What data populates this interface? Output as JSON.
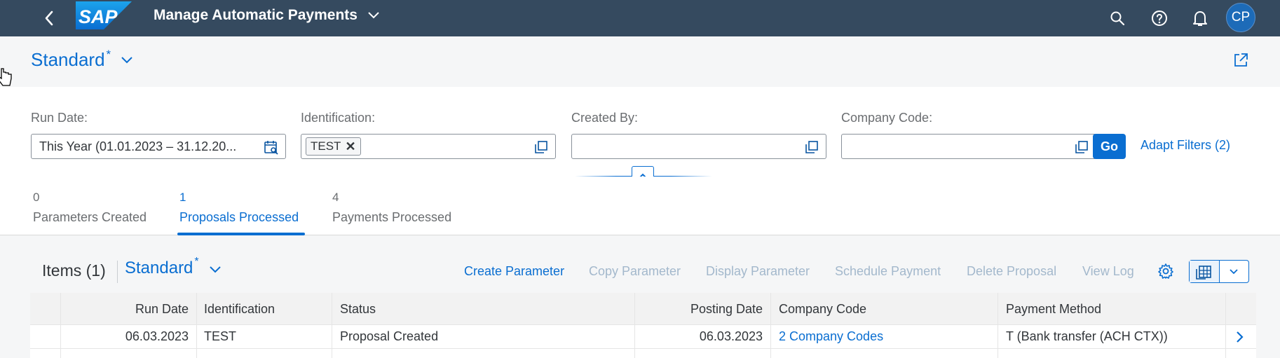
{
  "shell": {
    "app_title": "Manage Automatic Payments",
    "logo_text": "SAP",
    "avatar_initials": "CP"
  },
  "page_variant": {
    "name": "Standard",
    "modified_marker": "*"
  },
  "filters": [
    {
      "label": "Run Date:",
      "value": "This Year (01.01.2023 – 31.12.20..."
    },
    {
      "label": "Identification:",
      "tokens": [
        "TEST"
      ]
    },
    {
      "label": "Created By:",
      "value": ""
    },
    {
      "label": "Company Code:",
      "value": ""
    }
  ],
  "filter_actions": {
    "go_label": "Go",
    "adapt_label": "Adapt Filters (2)"
  },
  "tabs": [
    {
      "count": "0",
      "label": "Parameters Created",
      "active": false
    },
    {
      "count": "1",
      "label": "Proposals Processed",
      "active": true
    },
    {
      "count": "4",
      "label": "Payments Processed",
      "active": false
    }
  ],
  "table_toolbar": {
    "title": "Items (1)",
    "variant_name": "Standard",
    "modified_marker": "*",
    "actions": [
      {
        "label": "Create Parameter",
        "enabled": true
      },
      {
        "label": "Copy Parameter",
        "enabled": false
      },
      {
        "label": "Display Parameter",
        "enabled": false
      },
      {
        "label": "Schedule Payment",
        "enabled": false
      },
      {
        "label": "Delete Proposal",
        "enabled": false
      },
      {
        "label": "View Log",
        "enabled": false
      }
    ]
  },
  "table": {
    "columns": [
      "Run Date",
      "Identification",
      "Status",
      "Posting Date",
      "Company Code",
      "Payment Method"
    ],
    "rows": [
      {
        "run_date": "06.03.2023",
        "identification": "TEST",
        "status": "Proposal Created",
        "posting_date": "06.03.2023",
        "company_code": "2 Company Codes",
        "payment_method": "T (Bank transfer (ACH CTX))"
      }
    ]
  },
  "colors": {
    "shell_bg": "#354a5f",
    "accent": "#0a6ed1",
    "disabled_text": "#a3b8cc"
  }
}
